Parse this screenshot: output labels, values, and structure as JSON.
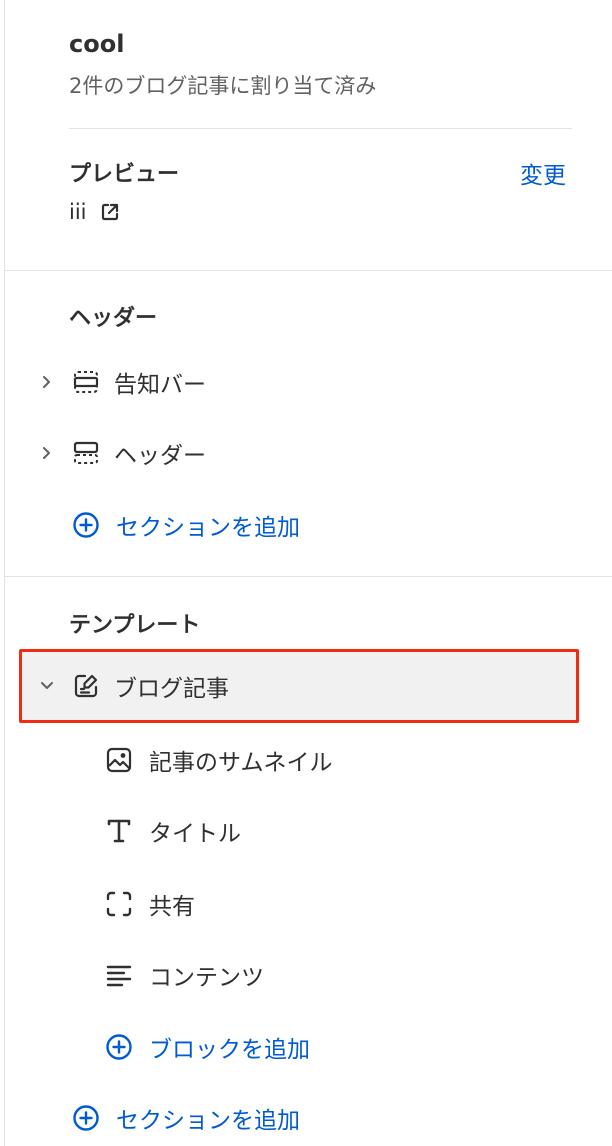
{
  "theme": {
    "name": "cool",
    "assigned": "2件のブログ記事に割り当て済み"
  },
  "preview": {
    "heading": "プレビュー",
    "change_link": "変更",
    "value": "iii"
  },
  "header_group": {
    "heading": "ヘッダー",
    "items": [
      {
        "label": "告知バー",
        "icon": "announcement-bar-icon"
      },
      {
        "label": "ヘッダー",
        "icon": "header-layout-icon"
      }
    ],
    "add_section": "セクションを追加"
  },
  "template_group": {
    "heading": "テンプレート",
    "selected_section": {
      "label": "ブログ記事",
      "icon": "blog-post-icon"
    },
    "blocks": [
      {
        "label": "記事のサムネイル",
        "icon": "image-icon"
      },
      {
        "label": "タイトル",
        "icon": "text-icon"
      },
      {
        "label": "共有",
        "icon": "share-icon"
      },
      {
        "label": "コンテンツ",
        "icon": "text-align-icon"
      }
    ],
    "add_block": "ブロックを追加",
    "add_section": "セクションを追加"
  },
  "colors": {
    "link": "#005bd3",
    "selection_border": "#ef2b11",
    "selected_bg": "#f1f1f1"
  }
}
